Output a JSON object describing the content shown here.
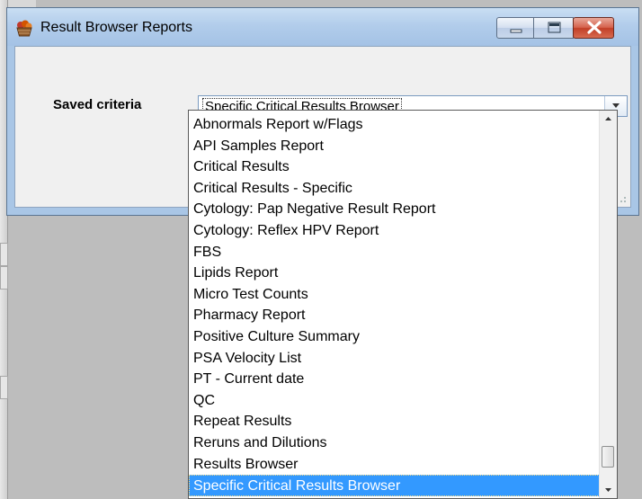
{
  "window": {
    "title": "Result Browser Reports",
    "icon": "basket-icon",
    "controls": [
      "minimize-icon",
      "maximize-icon",
      "close-icon"
    ]
  },
  "form": {
    "saved_criteria_label": "Saved criteria",
    "saved_criteria_value": "Specific Critical Results Browser"
  },
  "dropdown": {
    "items": [
      "Abnormals Report w/Flags",
      "API Samples Report",
      "Critical Results",
      "Critical Results - Specific",
      "Cytology:  Pap Negative Result Report",
      "Cytology:  Reflex HPV Report",
      "FBS",
      "Lipids Report",
      "Micro Test Counts",
      "Pharmacy Report",
      "Positive Culture Summary",
      "PSA Velocity List",
      "PT - Current date",
      "QC",
      "Repeat Results",
      "Reruns and Dilutions",
      "Results Browser",
      "Specific Critical Results Browser"
    ],
    "selected_index": 17
  },
  "colors": {
    "selection": "#3399ff",
    "titlebar": "#b2cdeb",
    "close_button": "#c13f28"
  }
}
